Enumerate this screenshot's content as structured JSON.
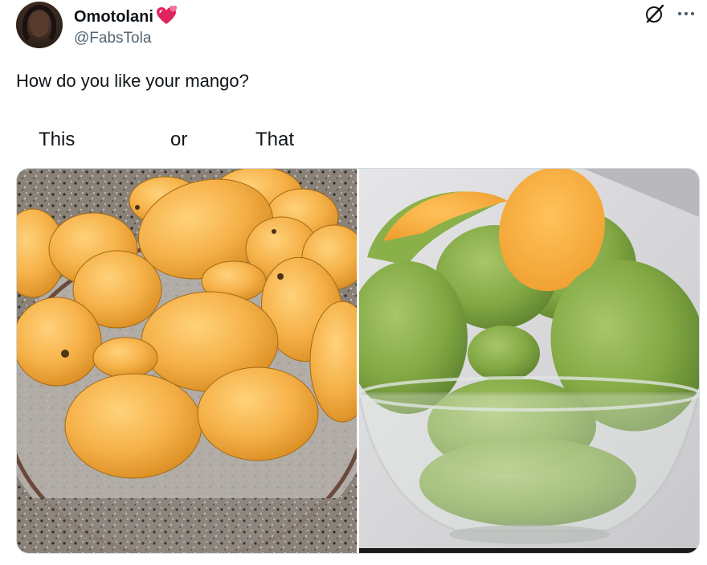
{
  "tweet": {
    "author": {
      "display_name": "Omotolani",
      "handle": "@FabsTola",
      "avatar_icon": "profile-photo",
      "name_emoji_icon": "two-hearts-emoji-icon"
    },
    "text": "How do you like your mango?",
    "choices": {
      "left": "This",
      "middle": "or",
      "right": "That"
    },
    "media": {
      "left_image": "yellow-ripe-mangoes-in-glass-platter",
      "right_image": "green-mangoes-in-glass-bowl-one-peeled"
    }
  },
  "icons": {
    "grok": "grok-icon",
    "more": "more-options-icon"
  },
  "colors": {
    "text_primary": "#0f1419",
    "text_secondary": "#536471",
    "border": "#cfd9de",
    "heart": "#e0245e"
  }
}
